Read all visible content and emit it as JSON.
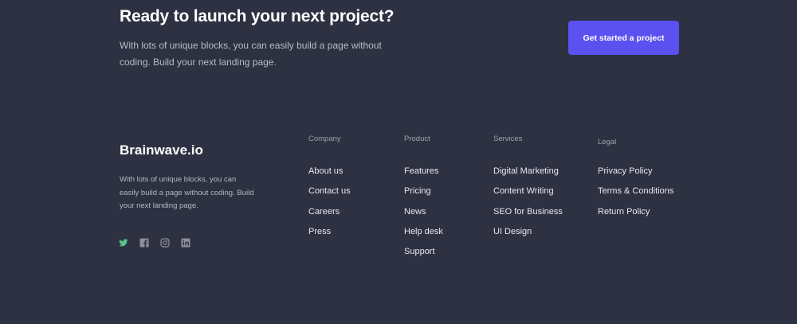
{
  "cta": {
    "title": "Ready to launch your next project?",
    "description": "With lots of unique blocks, you can easily build a page without coding. Build your next landing page.",
    "button_label": "Get started a project"
  },
  "brand": {
    "name": "Brainwave.io",
    "description": "With lots of unique blocks, you can easily build a page without coding. Build your next landing page."
  },
  "socials": [
    {
      "icon": "twitter-icon",
      "color": "#53c28b"
    },
    {
      "icon": "facebook-icon",
      "color": "#8d909c"
    },
    {
      "icon": "instagram-icon",
      "color": "#8d909c"
    },
    {
      "icon": "linkedin-icon",
      "color": "#8d909c"
    }
  ],
  "columns": {
    "company": {
      "heading": "Company",
      "links": [
        "About us",
        "Contact us",
        "Careers",
        "Press"
      ]
    },
    "product": {
      "heading": "Product",
      "links": [
        "Features",
        "Pricing",
        "News",
        "Help desk",
        "Support"
      ]
    },
    "services": {
      "heading": "Services",
      "links": [
        "Digital Marketing",
        "Content Writing",
        "SEO for Business",
        "UI Design"
      ]
    },
    "legal": {
      "heading": "Legal",
      "links": [
        "Privacy Policy",
        "Terms & Conditions",
        "Return Policy"
      ]
    }
  },
  "colors": {
    "background": "#2d3142",
    "accent": "#5b50f0",
    "twitter": "#53c28b"
  }
}
